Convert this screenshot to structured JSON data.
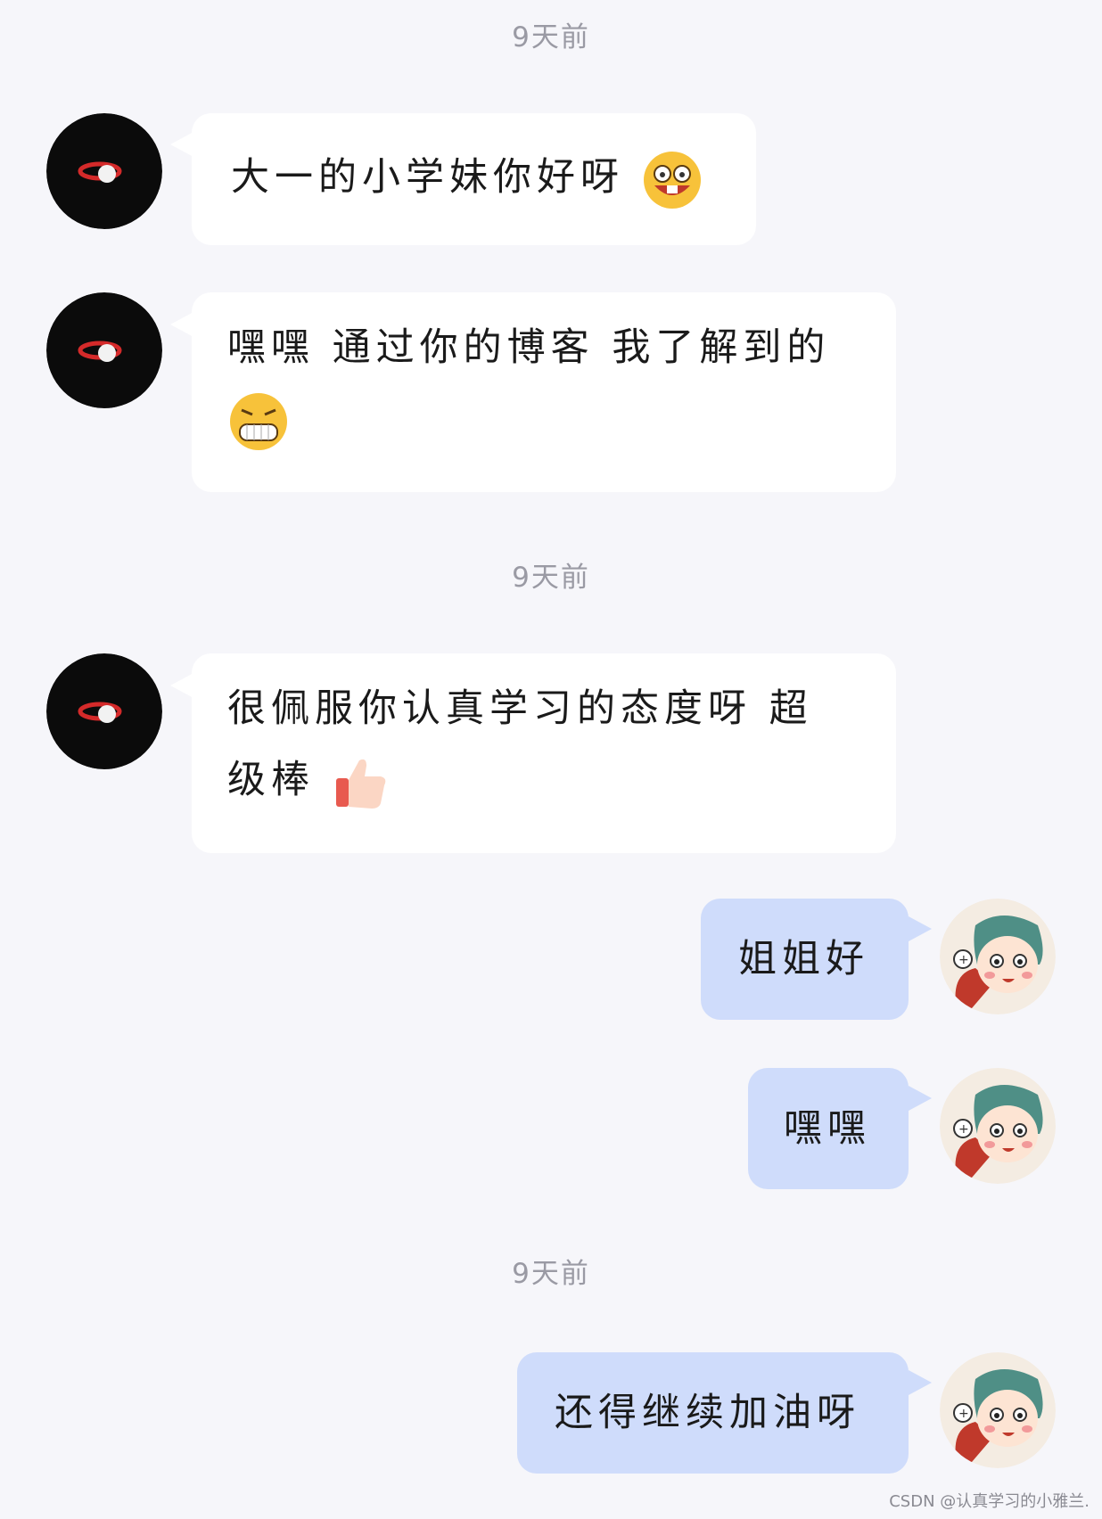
{
  "timestamps": [
    "9天前",
    "9天前",
    "9天前"
  ],
  "messages": [
    {
      "side": "in",
      "text": "大一的小学妹你好呀",
      "emoji": "grinning-buck-tooth-emoji"
    },
    {
      "side": "in",
      "text": "嘿嘿 通过你的博客 我了解到的",
      "emoji": "toothy-grin-emoji"
    },
    {
      "side": "in",
      "line1": "很佩服你认真学习的态度呀 超",
      "line2": "级棒",
      "emoji": "thumbs-up-emoji"
    },
    {
      "side": "out",
      "text": "姐姐好"
    },
    {
      "side": "out",
      "text": "嘿嘿"
    },
    {
      "side": "out",
      "text": "还得继续加油呀"
    }
  ],
  "watermark": "CSDN @认真学习的小雅兰.",
  "colors": {
    "background": "#f6f6fa",
    "incoming_bubble": "#ffffff",
    "outgoing_bubble": "#cfdcfb",
    "timestamp": "#9a9aa4"
  }
}
